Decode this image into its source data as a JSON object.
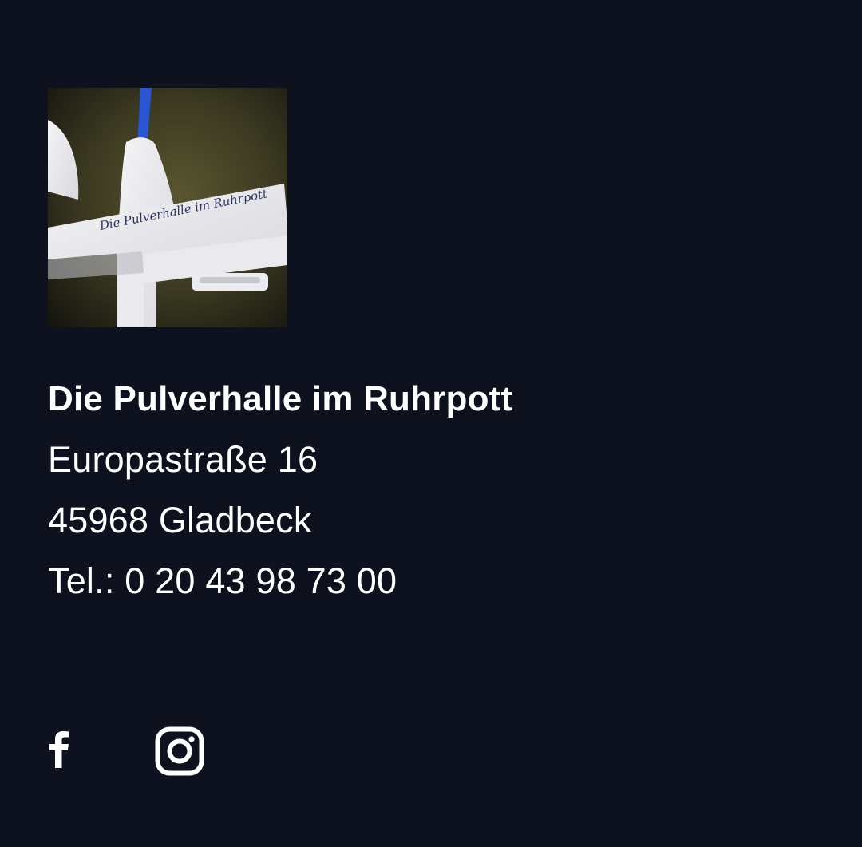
{
  "logo": {
    "caption": "Die Pulverhalle im Ruhrpott"
  },
  "address": {
    "name": "Die Pulverhalle im Ruhrpott",
    "street": "Europastraße 16",
    "city": "45968 Gladbeck",
    "phone": "Tel.: 0 20 43 98 73 00"
  },
  "social": {
    "icons": [
      "facebook-icon",
      "instagram-icon"
    ]
  },
  "colors": {
    "background": "#0e121f",
    "text": "#ffffff",
    "accent_blue": "#2a56d6"
  }
}
